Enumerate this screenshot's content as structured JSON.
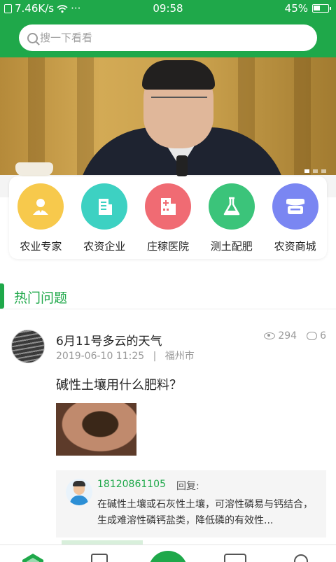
{
  "status_bar": {
    "network_speed": "7.46K/s",
    "more": "···",
    "time": "09:58",
    "battery": "45%"
  },
  "search": {
    "placeholder": "搜一下看看"
  },
  "banner": {
    "slide_count": 3,
    "active_slide": 1
  },
  "categories": [
    {
      "label": "农业专家",
      "icon": "expert-icon",
      "color": "#f7c94c"
    },
    {
      "label": "农资企业",
      "icon": "enterprise-building-icon",
      "color": "#3dd1c2"
    },
    {
      "label": "庄稼医院",
      "icon": "hospital-icon",
      "color": "#f06b73"
    },
    {
      "label": "测土配肥",
      "icon": "flask-icon",
      "color": "#3bc47a"
    },
    {
      "label": "农资商城",
      "icon": "store-icon",
      "color": "#7a86f2"
    }
  ],
  "section": {
    "title": "热门问题"
  },
  "post": {
    "title": "6月11号多云的天气",
    "datetime": "2019-06-10 11:25",
    "separator": "|",
    "location": "福州市",
    "views": "294",
    "comments": "6",
    "question": "碱性土壤用什么肥料？",
    "reply": {
      "user": "18120861105",
      "label": "回复:",
      "text": "在碱性土壤或石灰性土壤，可溶性磷易与钙结合，生成难溶性磷钙盐类，降低磷的有效性..."
    }
  },
  "colors": {
    "brand": "#1fa84a"
  }
}
